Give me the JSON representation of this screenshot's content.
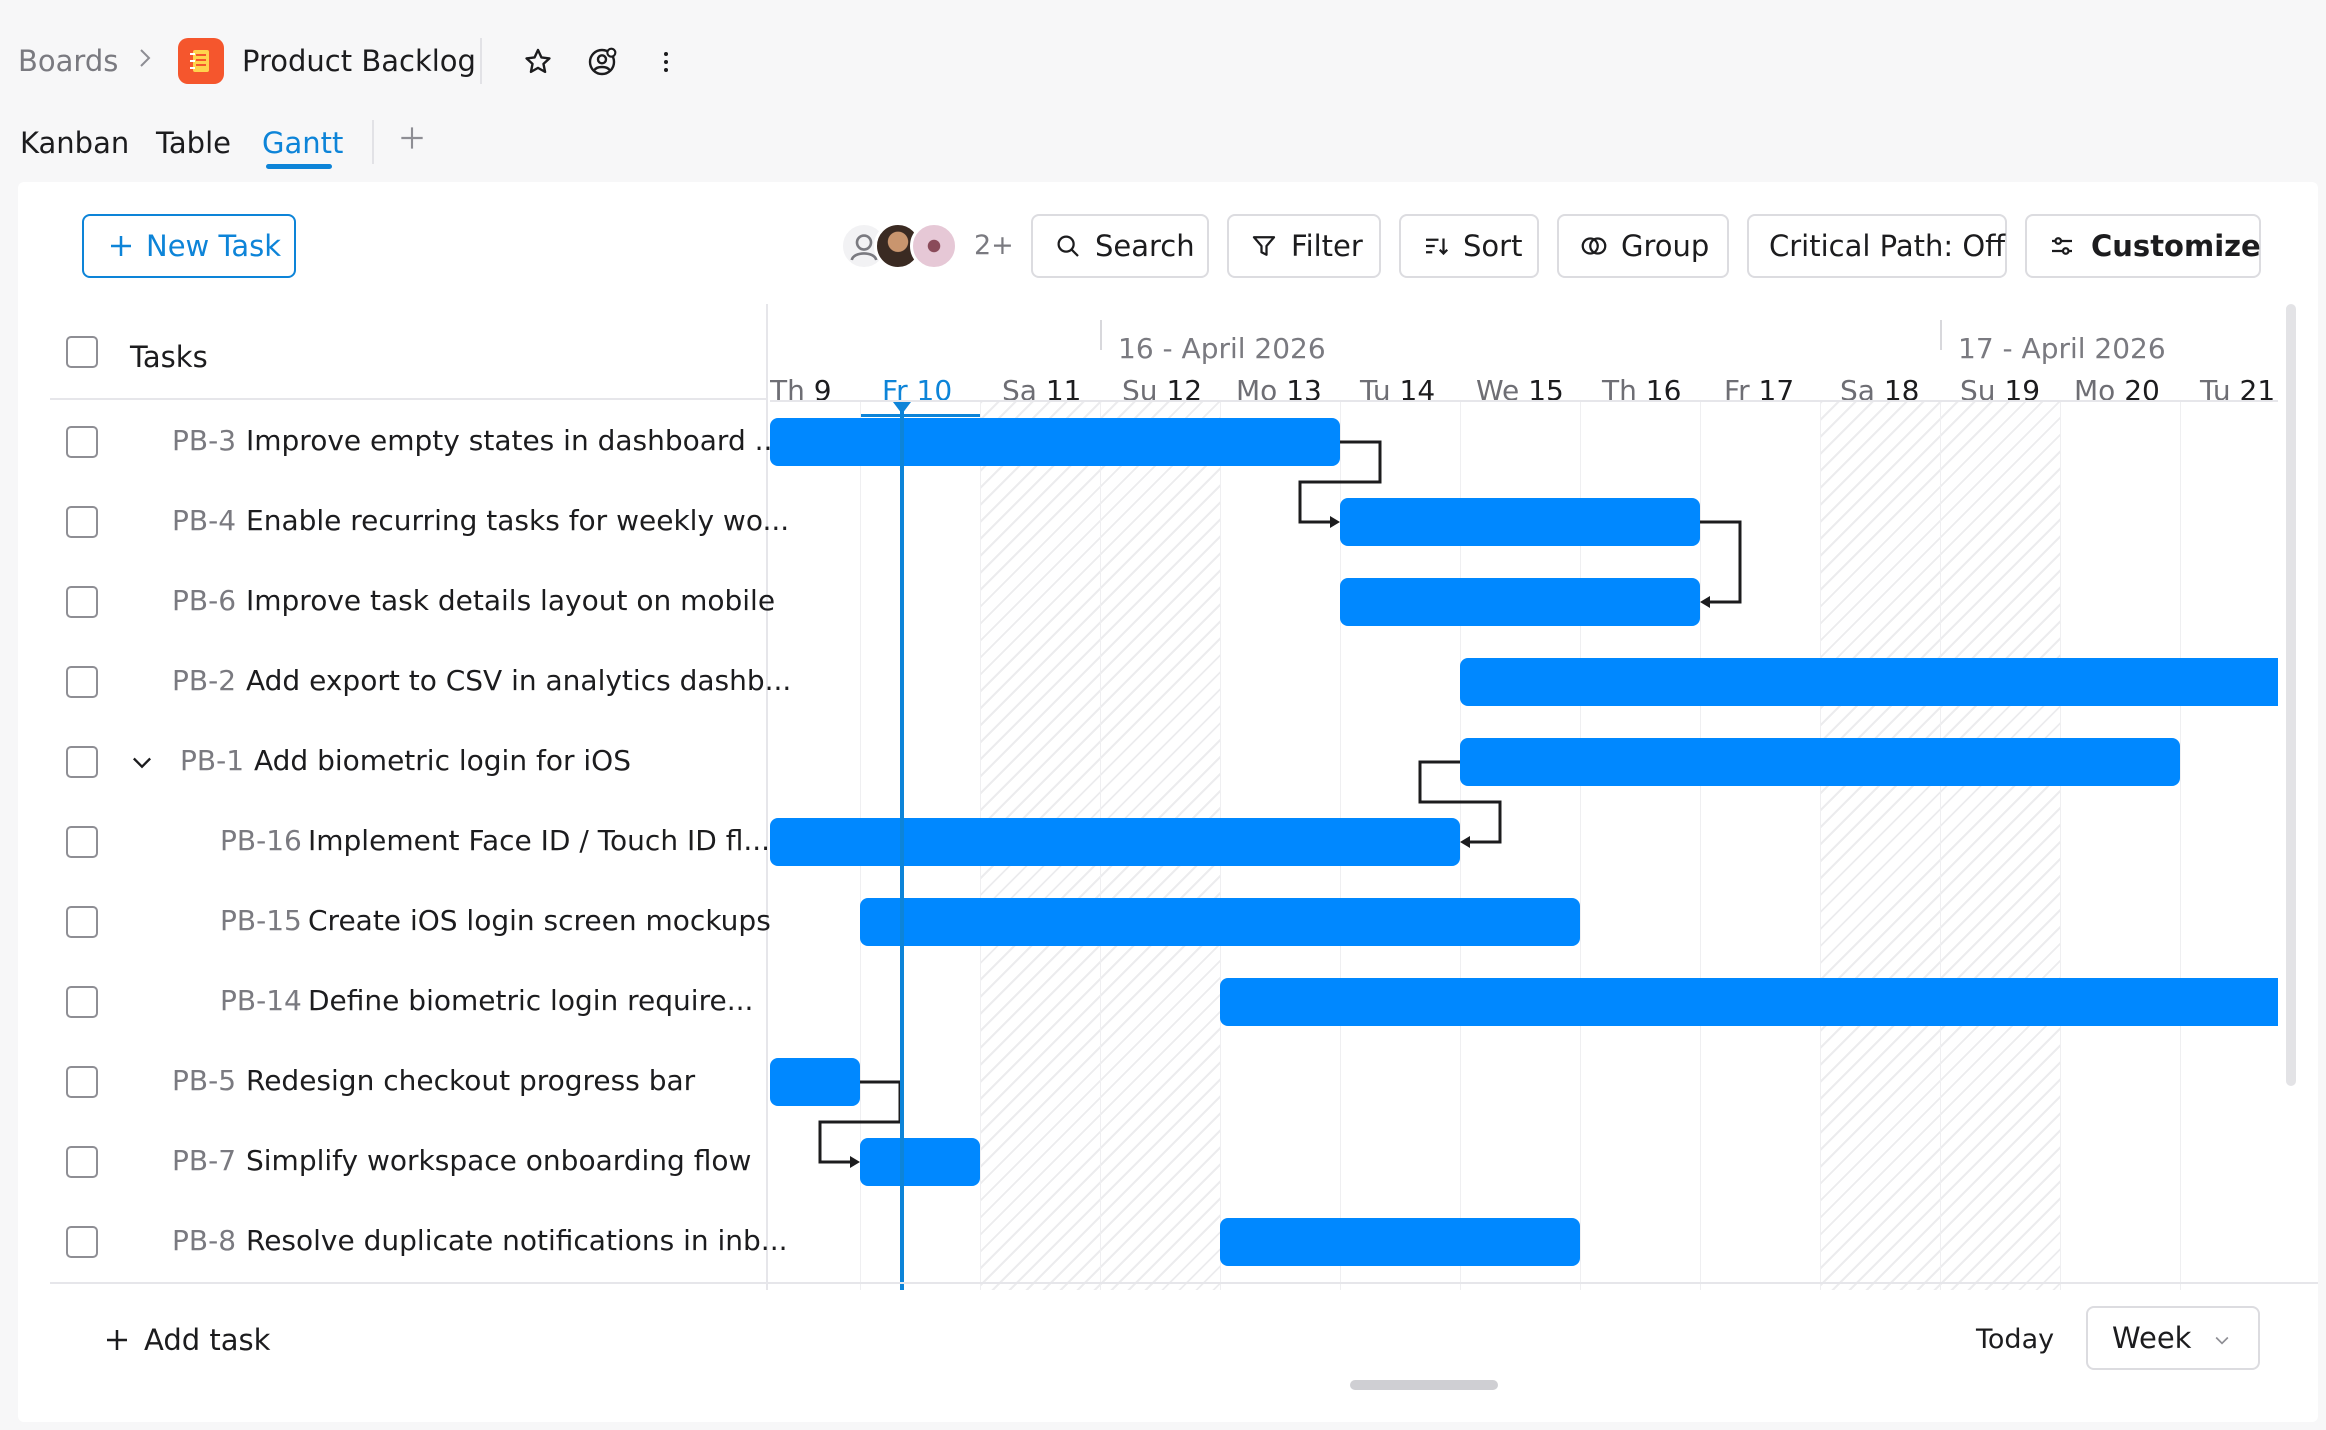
{
  "breadcrumb": {
    "root": "Boards",
    "board_title": "Product Backlog"
  },
  "icons": {
    "separator": "chevron-right-icon",
    "board": "notebook-icon",
    "favorite": "star-icon",
    "watch": "user-watch-icon",
    "more": "more-vertical-icon"
  },
  "tabs": [
    {
      "label": "Kanban",
      "active": false
    },
    {
      "label": "Table",
      "active": false
    },
    {
      "label": "Gantt",
      "active": true
    }
  ],
  "toolbar": {
    "new_task": "New Task",
    "avatars_more": "2+",
    "search": "Search",
    "filter": "Filter",
    "sort": "Sort",
    "group": "Group",
    "critical_path": "Critical Path: Off",
    "customize": "Customize"
  },
  "task_list": {
    "header": "Tasks",
    "rows": [
      {
        "id": "PB-3",
        "name": "Improve empty states in dashboard ..."
      },
      {
        "id": "PB-4",
        "name": "Enable recurring tasks for weekly wo..."
      },
      {
        "id": "PB-6",
        "name": "Improve task details layout on mobile"
      },
      {
        "id": "PB-2",
        "name": "Add export to CSV in analytics dashb..."
      },
      {
        "id": "PB-1",
        "name": "Add biometric login for iOS"
      },
      {
        "id": "PB-16",
        "name": "Implement Face ID / Touch ID fl..."
      },
      {
        "id": "PB-15",
        "name": "Create iOS login screen mockups"
      },
      {
        "id": "PB-14",
        "name": "Define biometric login require..."
      },
      {
        "id": "PB-5",
        "name": "Redesign checkout progress bar"
      },
      {
        "id": "PB-7",
        "name": "Simplify workspace onboarding flow"
      },
      {
        "id": "PB-8",
        "name": "Resolve duplicate notifications in inb..."
      }
    ]
  },
  "timeline": {
    "week_labels": [
      "16 - April 2026",
      "17 - April 2026"
    ],
    "days": [
      {
        "dow": "Th",
        "num": "9"
      },
      {
        "dow": "Fr",
        "num": "10"
      },
      {
        "dow": "Sa",
        "num": "11"
      },
      {
        "dow": "Su",
        "num": "12"
      },
      {
        "dow": "Mo",
        "num": "13"
      },
      {
        "dow": "Tu",
        "num": "14"
      },
      {
        "dow": "We",
        "num": "15"
      },
      {
        "dow": "Th",
        "num": "16"
      },
      {
        "dow": "Fr",
        "num": "17"
      },
      {
        "dow": "Sa",
        "num": "18"
      },
      {
        "dow": "Su",
        "num": "19"
      },
      {
        "dow": "Mo",
        "num": "20"
      },
      {
        "dow": "Tu",
        "num": "21"
      }
    ],
    "today": "Fr 10",
    "bar_color": "#0088ff",
    "accent_color": "#0d84d8"
  },
  "footer": {
    "add_task": "Add task",
    "today": "Today",
    "zoom": "Week"
  }
}
